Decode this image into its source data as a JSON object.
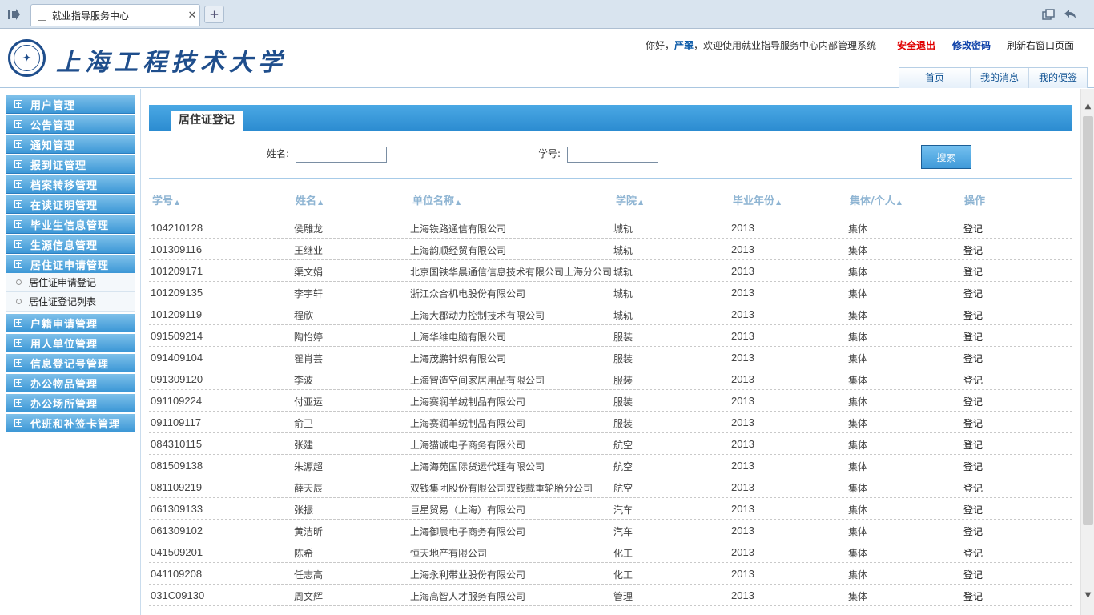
{
  "browser": {
    "tab_title": "就业指导服务中心",
    "close_glyph": "✕",
    "new_tab_glyph": "+"
  },
  "header": {
    "logo_text": "上海工程技术大学",
    "welcome_prefix": "你好，",
    "username": "严翠",
    "welcome_suffix": "，欢迎使用就业指导服务中心内部管理系统",
    "logout": "安全退出",
    "change_password": "修改密码",
    "refresh": "刷新右窗口页面",
    "nav": [
      "首页",
      "我的消息",
      "我的便签"
    ],
    "colors": {
      "logout": "#e00000",
      "change_password": "#0b3fa8"
    }
  },
  "sidebar": {
    "menus_top": [
      "用户管理",
      "公告管理",
      "通知管理",
      "报到证管理",
      "档案转移管理",
      "在读证明管理",
      "毕业生信息管理",
      "生源信息管理",
      "居住证申请管理"
    ],
    "submenus": [
      "居住证申请登记",
      "居住证登记列表"
    ],
    "menus_bottom": [
      "户籍申请管理",
      "用人单位管理",
      "信息登记号管理",
      "办公物品管理",
      "办公场所管理",
      "代班和补签卡管理"
    ]
  },
  "page": {
    "title": "居住证登记",
    "search": {
      "name_label": "姓名:",
      "name_value": "",
      "id_label": "学号:",
      "id_value": "",
      "button": "搜索"
    },
    "columns": [
      "学号",
      "姓名",
      "单位名称",
      "学院",
      "毕业年份",
      "集体/个人",
      "操作"
    ],
    "sort_glyph": "▲",
    "rows": [
      [
        "104210128",
        "侯雕龙",
        "上海铁路通信有限公司",
        "城轨",
        "2013",
        "集体",
        "登记"
      ],
      [
        "101309116",
        "王继业",
        "上海韵顺经贸有限公司",
        "城轨",
        "2013",
        "集体",
        "登记"
      ],
      [
        "101209171",
        "渠文娟",
        "北京国铁华晨通信信息技术有限公司上海分公司",
        "城轨",
        "2013",
        "集体",
        "登记"
      ],
      [
        "101209135",
        "李宇轩",
        "浙江众合机电股份有限公司",
        "城轨",
        "2013",
        "集体",
        "登记"
      ],
      [
        "101209119",
        "程欣",
        "上海大郡动力控制技术有限公司",
        "城轨",
        "2013",
        "集体",
        "登记"
      ],
      [
        "091509214",
        "陶怡婷",
        "上海华维电脑有限公司",
        "服装",
        "2013",
        "集体",
        "登记"
      ],
      [
        "091409104",
        "瞿肖芸",
        "上海茂鹏针织有限公司",
        "服装",
        "2013",
        "集体",
        "登记"
      ],
      [
        "091309120",
        "李波",
        "上海智造空间家居用品有限公司",
        "服装",
        "2013",
        "集体",
        "登记"
      ],
      [
        "091109224",
        "付亚运",
        "上海赛润羊绒制品有限公司",
        "服装",
        "2013",
        "集体",
        "登记"
      ],
      [
        "091109117",
        "俞卫",
        "上海赛润羊绒制品有限公司",
        "服装",
        "2013",
        "集体",
        "登记"
      ],
      [
        "084310115",
        "张建",
        "上海猫诚电子商务有限公司",
        "航空",
        "2013",
        "集体",
        "登记"
      ],
      [
        "081509138",
        "朱源超",
        "上海海苑国际货运代理有限公司",
        "航空",
        "2013",
        "集体",
        "登记"
      ],
      [
        "081109219",
        "薛天辰",
        "双钱集团股份有限公司双钱载重轮胎分公司",
        "航空",
        "2013",
        "集体",
        "登记"
      ],
      [
        "061309133",
        "张振",
        "巨星贸易（上海）有限公司",
        "汽车",
        "2013",
        "集体",
        "登记"
      ],
      [
        "061309102",
        "黄洁昕",
        "上海御晨电子商务有限公司",
        "汽车",
        "2013",
        "集体",
        "登记"
      ],
      [
        "041509201",
        "陈希",
        "恒天地产有限公司",
        "化工",
        "2013",
        "集体",
        "登记"
      ],
      [
        "041109208",
        "任志高",
        "上海永利带业股份有限公司",
        "化工",
        "2013",
        "集体",
        "登记"
      ],
      [
        "031C09130",
        "周文辉",
        "上海高智人才服务有限公司",
        "管理",
        "2013",
        "集体",
        "登记"
      ]
    ]
  }
}
